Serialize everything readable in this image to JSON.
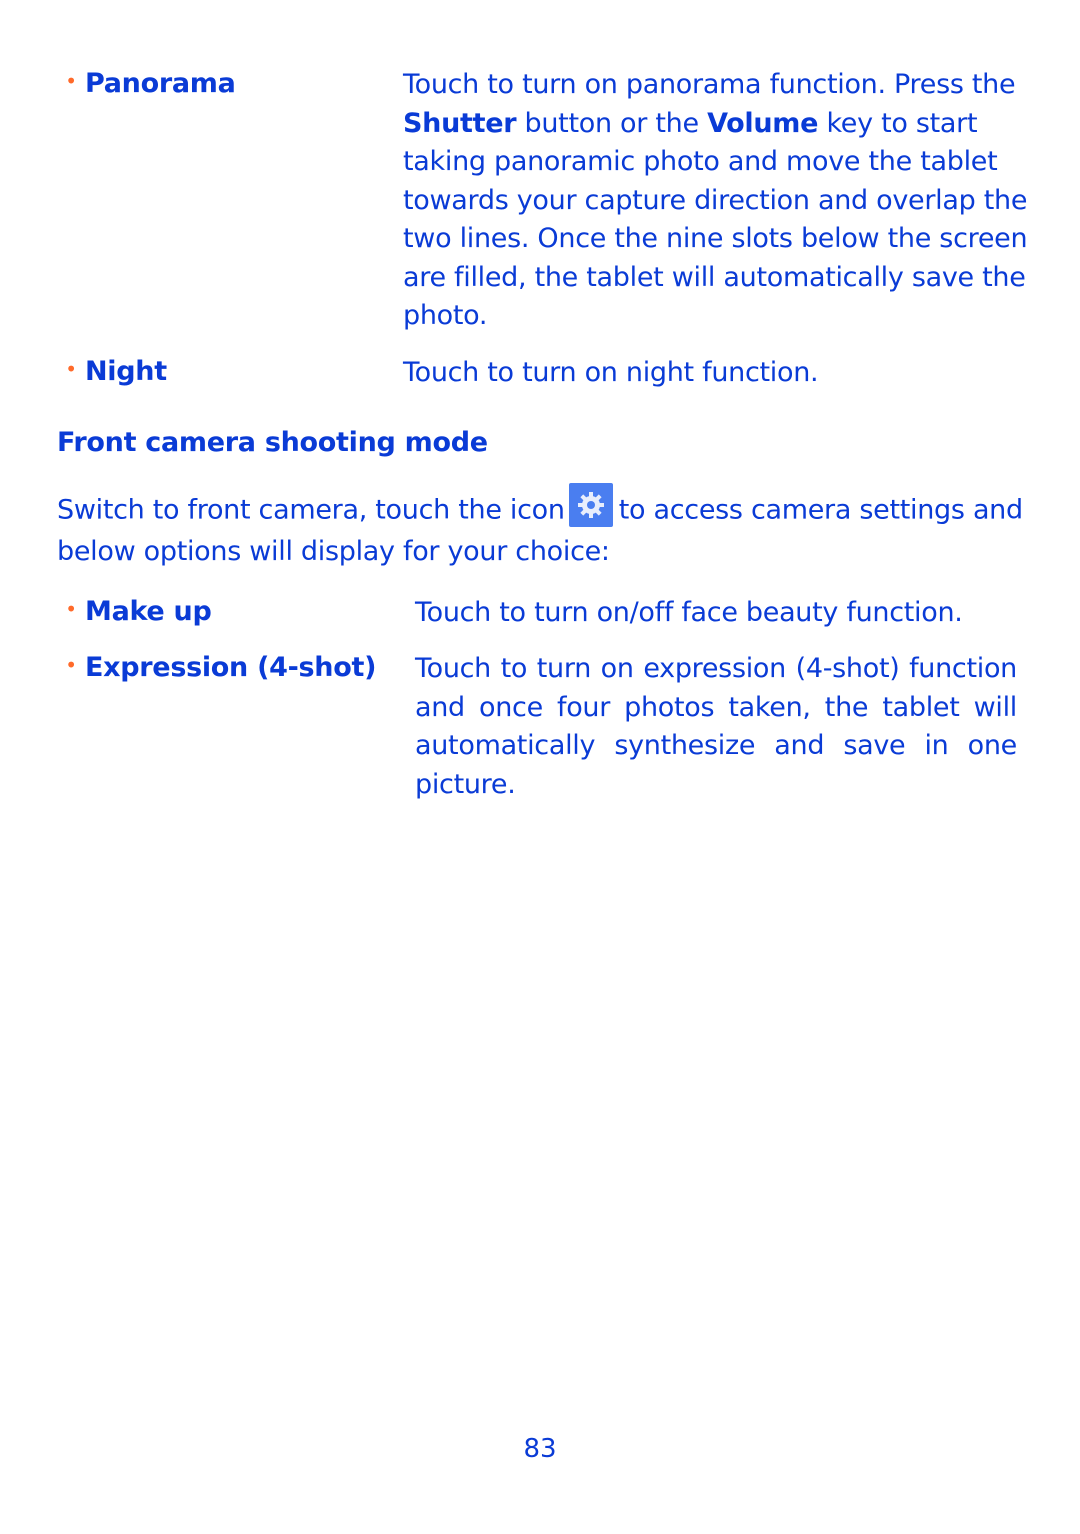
{
  "rear_modes": [
    {
      "term": "Panorama",
      "desc_parts": {
        "p1": "Touch to turn on panorama function. Press the",
        "b1": "Shutter",
        "p2": " button or the ",
        "b2": "Volume",
        "p3": " key to start taking panoramic photo and move the tablet towards your capture direction and overlap the two lines. Once the nine slots below the screen are filled, the tablet will automatically save the photo."
      }
    },
    {
      "term": "Night",
      "desc": "Touch to turn on night function."
    }
  ],
  "front_section": {
    "heading": "Front camera shooting mode",
    "intro_before_icon": "Switch to front camera, touch the icon",
    "icon": "settings-gear-icon",
    "intro_after_icon": "to access camera settings and below options will display for your choice:",
    "modes": [
      {
        "term": "Make up",
        "desc": "Touch to turn on/off face beauty function."
      },
      {
        "term": "Expression (4-shot)",
        "desc": "Touch to turn on expression (4-shot) function and once four photos taken, the tablet will automatically synthesize and save in one picture."
      }
    ]
  },
  "page_number": "83",
  "colors": {
    "text": "#0a3bd6",
    "bullet": "#ff6a2a",
    "icon_bg": "#4a7ef0"
  }
}
